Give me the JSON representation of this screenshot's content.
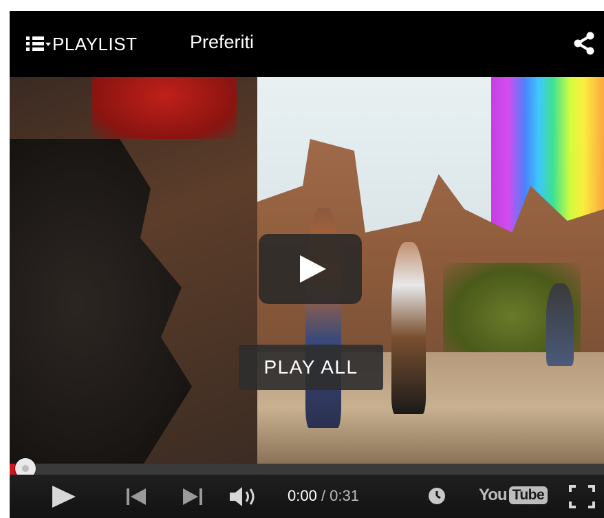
{
  "topbar": {
    "playlist_label": "PLAYLIST",
    "playlist_name": "Preferiti",
    "icons": {
      "list": "list-icon",
      "dropdown": "caret-down-icon",
      "share": "share-icon"
    }
  },
  "overlay": {
    "play_all_label": "PLAY ALL",
    "play_icon": "play-icon"
  },
  "controls": {
    "current_time": "0:00",
    "separator": " / ",
    "duration": "0:31",
    "icons": {
      "play": "play-icon",
      "previous": "skip-previous-icon",
      "next": "skip-next-icon",
      "volume": "volume-icon",
      "watch_later": "clock-icon",
      "fullscreen": "fullscreen-icon"
    },
    "youtube_logo": {
      "you": "You",
      "tube": "Tube"
    }
  },
  "progress": {
    "played_fraction": 0.0
  },
  "colors": {
    "progress_red": "#cc181e",
    "bar_bg": "#121212",
    "text": "#ffffff"
  }
}
